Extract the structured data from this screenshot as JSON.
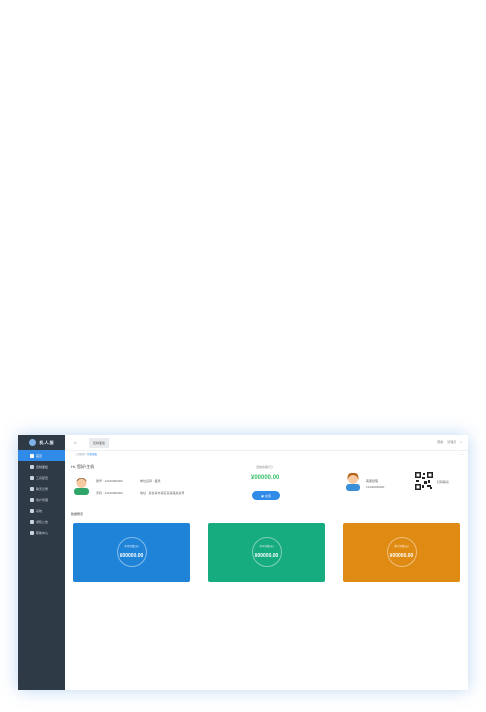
{
  "sidebar": {
    "logo_text": "机.人.服",
    "items": [
      {
        "label": "首页"
      },
      {
        "label": "控制面板"
      },
      {
        "label": "工具配置"
      },
      {
        "label": "聊天记录"
      },
      {
        "label": "用户管理"
      },
      {
        "label": "系统"
      },
      {
        "label": "通知公告"
      },
      {
        "label": "帮助中心"
      }
    ]
  },
  "topbar": {
    "home_icon": "home",
    "tab_label": "控制面板",
    "right_items": [
      "帮助",
      "管理员",
      "×"
    ]
  },
  "breadcrumb": {
    "path": "工具配置 / ",
    "current": "控制面板"
  },
  "profile": {
    "greeting": "Hi, 您好!主机",
    "row1_left": "账号 : 13100000000",
    "row1_right": "单位名称 : 星辰",
    "row2_left": "手机 : 13100000000",
    "row2_right": "地址 : 某省某市某区某某路某某号"
  },
  "balance": {
    "label": "当前余额(元)",
    "value": "¥00000.00",
    "recharge_label": "充值"
  },
  "agent": {
    "line1": "客服经理",
    "line2": "13100000000"
  },
  "qr": {
    "label": "扫码联系"
  },
  "stats": {
    "title": "数据概览",
    "cards": [
      {
        "label": "本月消费(元)",
        "value": "¥00000.00",
        "color": "#1f84d8"
      },
      {
        "label": "本年消费(元)",
        "value": "¥00000.00",
        "color": "#17ab80"
      },
      {
        "label": "累计消费(元)",
        "value": "¥00000.00",
        "color": "#df8b13"
      }
    ]
  }
}
